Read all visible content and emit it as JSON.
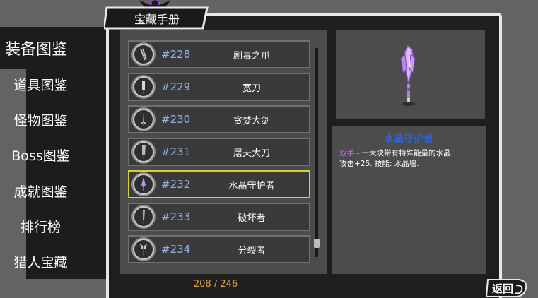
{
  "title": "宝藏手册",
  "sidebar": {
    "tabs": [
      {
        "label": "装备图鉴",
        "active": true
      },
      {
        "label": "道具图鉴",
        "active": false
      },
      {
        "label": "怪物图鉴",
        "active": false
      },
      {
        "label": "Boss图鉴",
        "active": false
      },
      {
        "label": "成就图鉴",
        "active": false
      },
      {
        "label": "排行榜",
        "active": false
      },
      {
        "label": "猎人宝藏",
        "active": false
      }
    ]
  },
  "list": {
    "items": [
      {
        "num": "#228",
        "name": "剧毒之爪",
        "icon": "claw-icon",
        "selected": false
      },
      {
        "num": "#229",
        "name": "宽刀",
        "icon": "broad-blade-icon",
        "selected": false
      },
      {
        "num": "#230",
        "name": "贪婪大剑",
        "icon": "greatsword-icon",
        "selected": false
      },
      {
        "num": "#231",
        "name": "屠夫大刀",
        "icon": "cleaver-icon",
        "selected": false
      },
      {
        "num": "#232",
        "name": "水晶守护者",
        "icon": "crystal-sword-icon",
        "selected": true
      },
      {
        "num": "#233",
        "name": "破坏者",
        "icon": "breaker-icon",
        "selected": false
      },
      {
        "num": "#234",
        "name": "分裂者",
        "icon": "splitter-axe-icon",
        "selected": false
      }
    ]
  },
  "detail": {
    "name": "水晶守护者",
    "hand_type": "双手",
    "description_line1": " - 一大块带有特殊能量的水晶.",
    "description_line2": "攻击+25. 技能: 水晶墙.",
    "preview_icon": "crystal-sword-icon"
  },
  "counter": "208 / 246",
  "back_button": {
    "label": "返回",
    "icon": "back-swirl-icon"
  },
  "colors": {
    "background": "#636363",
    "panel": "#4c4c4c",
    "frame": "#1e1e1e",
    "selected_border": "#d8cb3d",
    "item_number": "#8fb4e8",
    "detail_title": "#2a6df0",
    "hand_type": "#d36bf5",
    "counter": "#e5a63a"
  }
}
